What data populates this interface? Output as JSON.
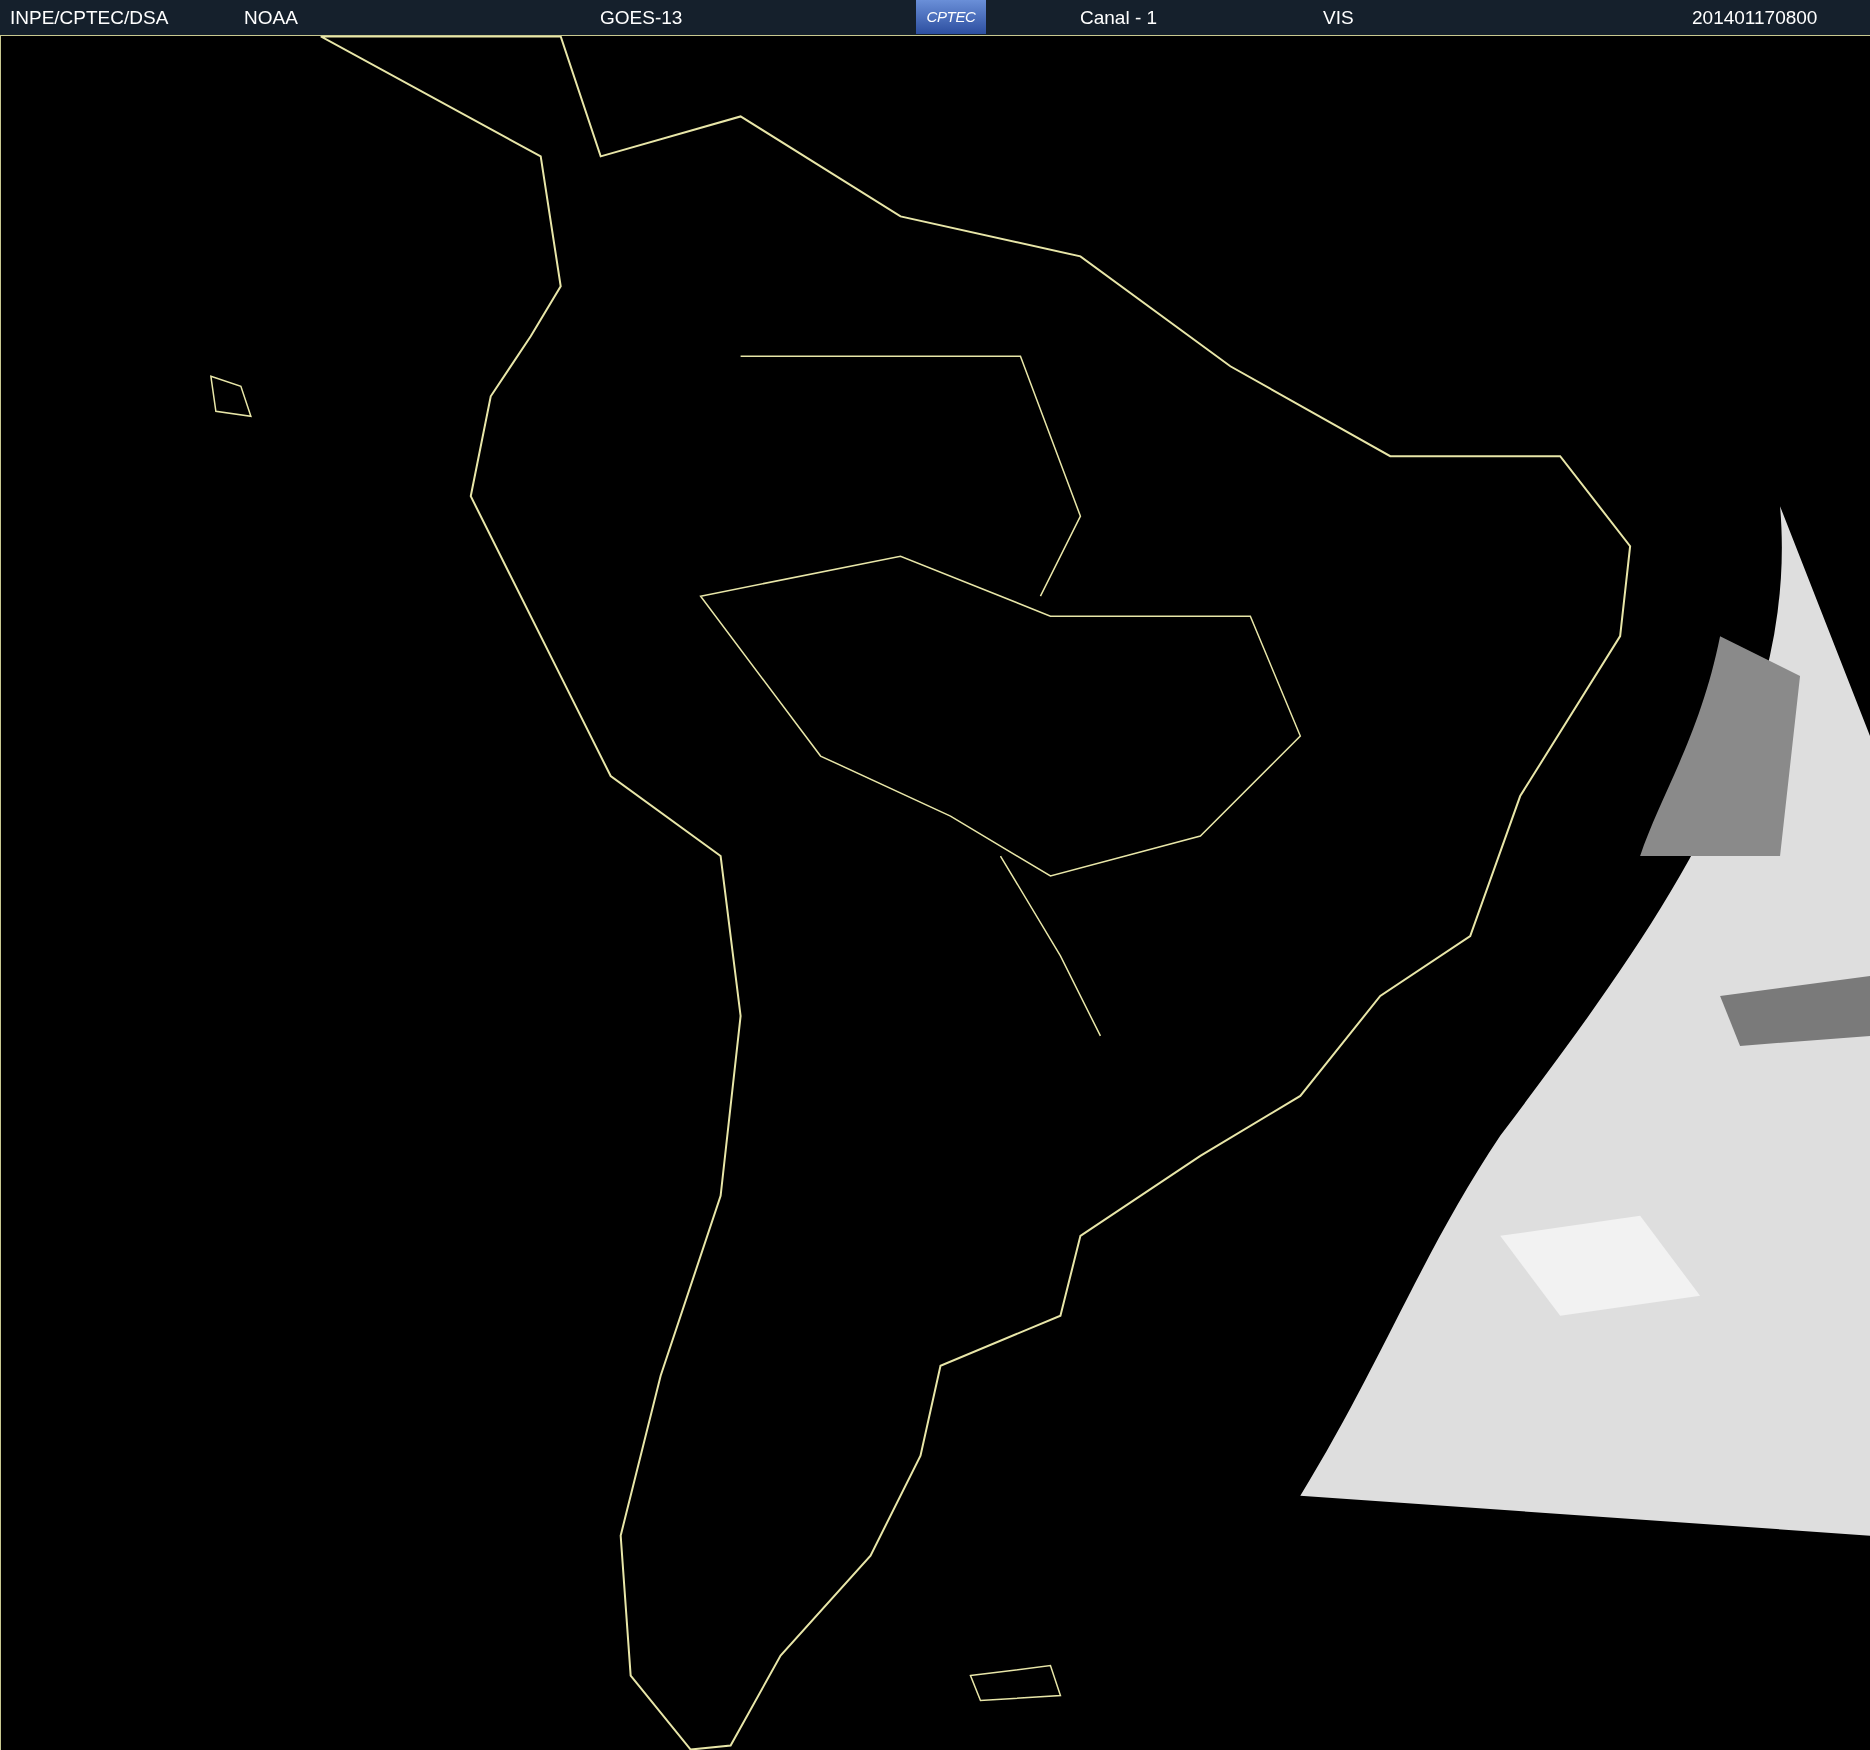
{
  "header": {
    "items": [
      {
        "kind": "text",
        "label": "INPE/CPTEC/DSA"
      },
      {
        "kind": "text",
        "label": "NOAA"
      },
      {
        "kind": "text",
        "label": "GOES-13"
      },
      {
        "kind": "logo",
        "label": "CPTEC"
      },
      {
        "kind": "text",
        "label": "Canal - 1"
      },
      {
        "kind": "text",
        "label": "VIS"
      },
      {
        "kind": "text",
        "label": "201401170800"
      }
    ]
  }
}
